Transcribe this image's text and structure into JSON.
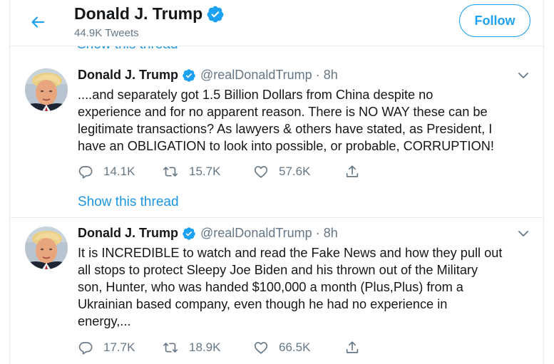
{
  "header": {
    "name": "Donald J. Trump",
    "tweet_count": "44.9K Tweets",
    "follow_label": "Follow",
    "partial_link": "Show this thread"
  },
  "tweets": [
    {
      "name": "Donald J. Trump",
      "handle": "@realDonaldTrump",
      "separator": "·",
      "time": "8h",
      "lines": [
        "....and separately got 1.5 Billion Dollars from China despite no",
        "experience and for no apparent reason. There is NO WAY these can be",
        "legitimate transactions? As lawyers & others have stated, as President, I",
        "have an OBLIGATION to look into possible, or probable, CORRUPTION!"
      ],
      "replies": "14.1K",
      "retweets": "15.7K",
      "likes": "57.6K",
      "show_thread": "Show this thread"
    },
    {
      "name": "Donald J. Trump",
      "handle": "@realDonaldTrump",
      "separator": "·",
      "time": "8h",
      "lines": [
        "It is INCREDIBLE to watch and read the Fake News and how they pull out",
        "all stops to protect Sleepy Joe Biden and his thrown out of the Military",
        "son, Hunter, who was handed $100,000 a month (Plus,Plus) from a",
        "Ukrainian based company, even though he had no experience in",
        "energy,..."
      ],
      "replies": "17.7K",
      "retweets": "18.9K",
      "likes": "66.5K"
    }
  ],
  "colors": {
    "accent": "#1da1f2",
    "link": "#1b95e0",
    "text": "#14171a",
    "secondary": "#657786",
    "border": "#e6ecf0"
  },
  "icons": {
    "back": "arrow-left-icon",
    "verified": "verified-badge-icon",
    "caret": "chevron-down-icon",
    "reply": "reply-icon",
    "retweet": "retweet-icon",
    "like": "heart-icon",
    "share": "share-icon"
  }
}
